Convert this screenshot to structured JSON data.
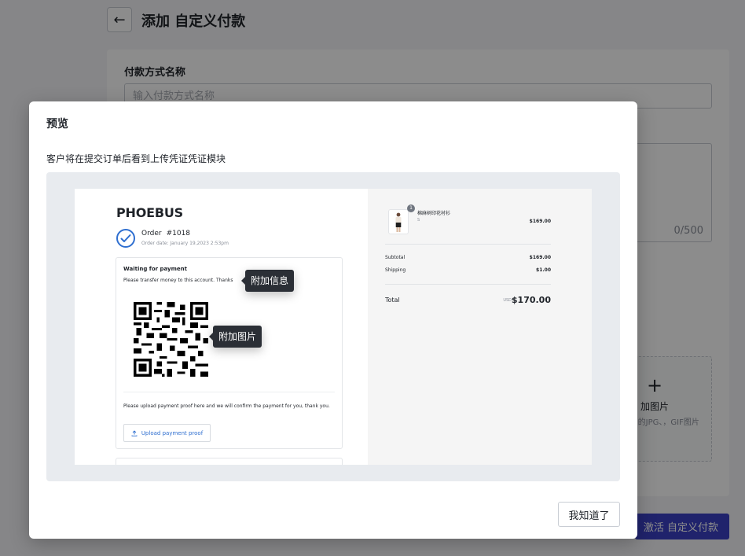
{
  "page": {
    "title": "添加 自定义付款",
    "back_label": "←",
    "field_name_label": "付款方式名称",
    "field_name_placeholder": "输入付款方式名称",
    "char_count": "0/500",
    "upload_plus": "+",
    "upload_label": "加图片",
    "upload_hint": "MB以内的JPG、，GIF图片",
    "activate_label": "激活 自定义付款"
  },
  "modal": {
    "title": "预览",
    "description": "客户将在提交订单后看到上传凭证凭证模块",
    "ok_label": "我知道了"
  },
  "checkout": {
    "shop_name": "PHOEBUS",
    "order_label": "Order",
    "order_number": "#1018",
    "order_date": "Order date:  January 19,2023 2:53pm",
    "payment_title": "Waiting for payment",
    "payment_info": "Please transfer money to this account. Thanks",
    "upload_instructions": "Please upload payment proof here and we will confirm the payment for you, thank you.",
    "upload_button": "Upload payment proof",
    "upload_icon": "upload-icon",
    "tooltip_info": "附加信息",
    "tooltip_image": "附加图片",
    "product_quantity": "1",
    "product_name": "棉麻树印花衬衫",
    "product_variant": "S",
    "product_price": "$169.00",
    "subtotal_label": "Subtotal",
    "subtotal_value": "$169.00",
    "shipping_label": "Shipping",
    "shipping_value": "$1.00",
    "total_label": "Total",
    "total_currency": "USD",
    "total_value": "$170.00"
  },
  "colors": {
    "primary": "#3b41c5",
    "link": "#2f6fd0",
    "tooltip_bg": "#2b2f36"
  }
}
